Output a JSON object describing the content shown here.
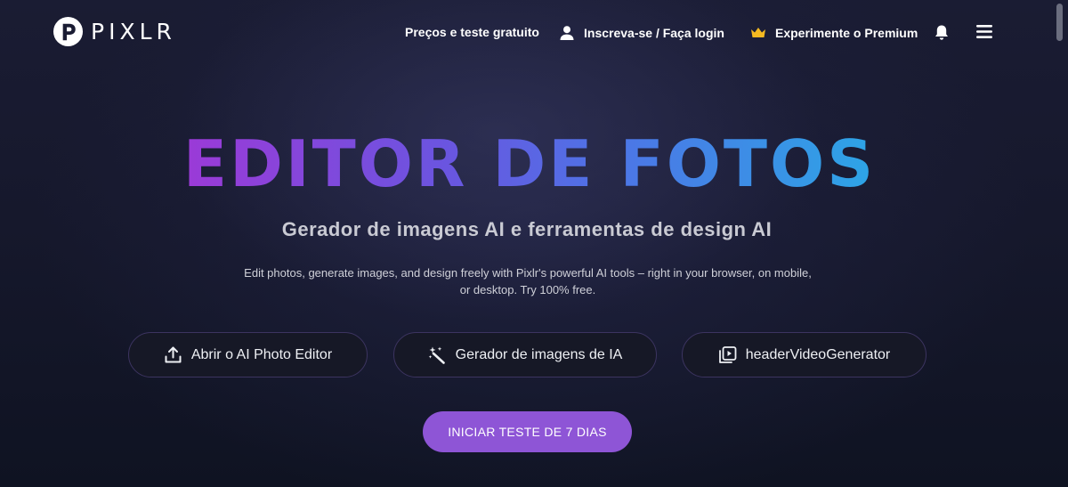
{
  "header": {
    "logo_text": "PIXLR",
    "nav": {
      "pricing": "Preços e teste gratuito",
      "login": "Inscreva-se / Faça login",
      "premium": "Experimente o Premium"
    },
    "icons": [
      "pixlr-logo-icon",
      "user-icon",
      "crown-icon",
      "bell-icon",
      "hamburger-menu-icon"
    ],
    "crown_color": "#f5b921"
  },
  "hero": {
    "title": "EDITOR DE FOTOS",
    "subtitle": "Gerador de imagens AI e ferramentas de design AI",
    "description_line1": "Edit photos, generate images, and design freely with Pixlr's powerful AI tools – right in your browser, on mobile,",
    "description_line2": "or desktop. Try 100% free.",
    "title_gradient": [
      "#9b3ad7",
      "#6a55e0",
      "#4f72e6",
      "#2da5e6"
    ]
  },
  "actions": {
    "photo_editor": "Abrir o AI Photo Editor",
    "image_generator": "Gerador de imagens de IA",
    "video_generator": "headerVideoGenerator",
    "icons": [
      "upload-icon",
      "magic-wand-icon",
      "video-play-icon"
    ]
  },
  "cta": {
    "label": "INICIAR TESTE DE 7 DIAS",
    "color": "#8e55d6"
  }
}
